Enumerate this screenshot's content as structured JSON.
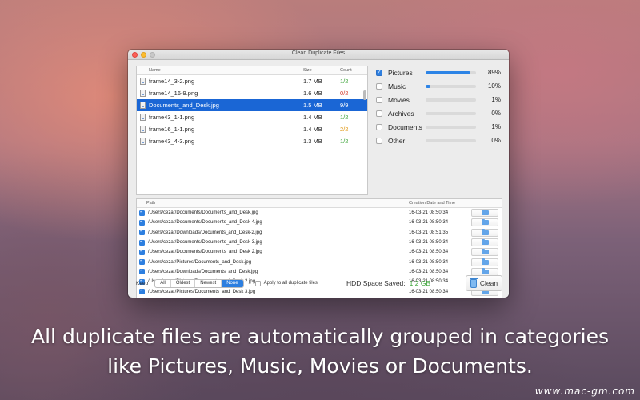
{
  "window": {
    "title": "Clean Duplicate Files"
  },
  "file_table": {
    "headers": {
      "name": "Name",
      "size": "Size",
      "count": "Count"
    },
    "rows": [
      {
        "name": "frame14_3-2.png",
        "size": "1.7 MB",
        "count": "1/2",
        "status": "green",
        "selected": false
      },
      {
        "name": "frame14_16-9.png",
        "size": "1.6 MB",
        "count": "0/2",
        "status": "red",
        "selected": false
      },
      {
        "name": "Documents_and_Desk.jpg",
        "size": "1.5 MB",
        "count": "9/9",
        "status": "red",
        "selected": true
      },
      {
        "name": "frame43_1-1.png",
        "size": "1.4 MB",
        "count": "1/2",
        "status": "green",
        "selected": false
      },
      {
        "name": "frame16_1-1.png",
        "size": "1.4 MB",
        "count": "2/2",
        "status": "orange",
        "selected": false
      },
      {
        "name": "frame43_4-3.png",
        "size": "1.3 MB",
        "count": "1/2",
        "status": "green",
        "selected": false
      }
    ]
  },
  "categories": [
    {
      "label": "Pictures",
      "percent": "89%",
      "fill": 0.89,
      "checked": true
    },
    {
      "label": "Music",
      "percent": "10%",
      "fill": 0.1,
      "checked": false
    },
    {
      "label": "Movies",
      "percent": "1%",
      "fill": 0.01,
      "checked": false
    },
    {
      "label": "Archives",
      "percent": "0%",
      "fill": 0.0,
      "checked": false
    },
    {
      "label": "Documents",
      "percent": "1%",
      "fill": 0.01,
      "checked": false
    },
    {
      "label": "Other",
      "percent": "0%",
      "fill": 0.0,
      "checked": false
    }
  ],
  "path_table": {
    "headers": {
      "path": "Path",
      "date": "Creation Date and Time"
    },
    "rows": [
      {
        "path": "/Users/cezar/Documents/Documents_and_Desk.jpg",
        "date": "16-03-21 08:50:34",
        "checked": true
      },
      {
        "path": "/Users/cezar/Documents/Documents_and_Desk 4.jpg",
        "date": "16-03-21 08:50:34",
        "checked": true
      },
      {
        "path": "/Users/cezar/Downloads/Documents_and_Desk-2.jpg",
        "date": "16-03-21 08:51:35",
        "checked": true
      },
      {
        "path": "/Users/cezar/Documents/Documents_and_Desk 3.jpg",
        "date": "16-03-21 08:50:34",
        "checked": true
      },
      {
        "path": "/Users/cezar/Documents/Documents_and_Desk 2.jpg",
        "date": "16-03-21 08:50:34",
        "checked": true
      },
      {
        "path": "/Users/cezar/Pictures/Documents_and_Desk.jpg",
        "date": "16-03-21 08:50:34",
        "checked": true
      },
      {
        "path": "/Users/cezar/Downloads/Documents_and_Desk.jpg",
        "date": "16-03-21 08:50:34",
        "checked": true
      },
      {
        "path": "/Users/cezar/Pictures/Documents_and_Desk 2.jpg",
        "date": "16-03-21 08:50:34",
        "checked": true
      },
      {
        "path": "/Users/cezar/Pictures/Documents_and_Desk 3.jpg",
        "date": "16-03-21 08:50:34",
        "checked": true
      }
    ]
  },
  "bottom": {
    "keep_label": "Keep",
    "keep_options": [
      "All",
      "Oldest",
      "Newest",
      "None"
    ],
    "keep_selected": "None",
    "apply_label": "Apply to all duplicate files",
    "hdd_label": "HDD Space Saved:",
    "hdd_value": "1.2 GB",
    "clean_label": "Clean"
  },
  "caption": {
    "line1": "All duplicate files are automatically grouped in categories",
    "line2": "like Pictures, Music, Movies or Documents."
  },
  "watermark": "www.mac-gm.com",
  "colors": {
    "accent": "#2d7fe0",
    "selected_row": "#1a66d5",
    "count_green": "#3aa336",
    "count_red": "#d43b2c",
    "count_orange": "#e0960f"
  }
}
